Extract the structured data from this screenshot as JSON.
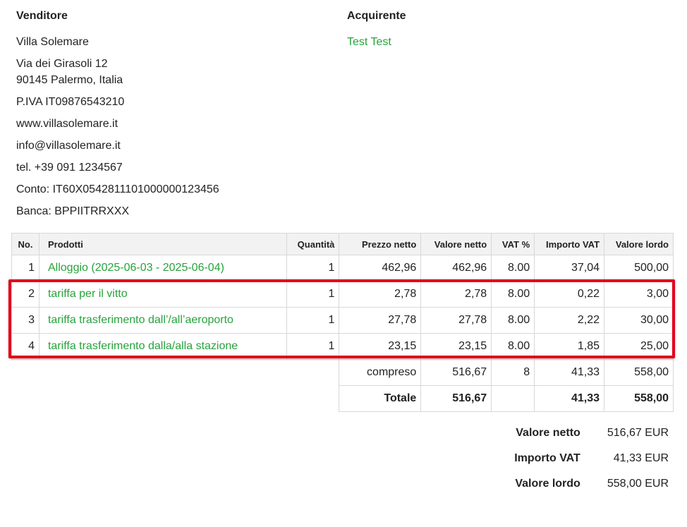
{
  "seller": {
    "heading": "Venditore",
    "name": "Villa Solemare",
    "street": "Via dei Girasoli 12",
    "city": "90145 Palermo, Italia",
    "vat": "P.IVA IT09876543210",
    "website": "www.villasolemare.it",
    "email": "info@villasolemare.it",
    "phone": "tel. +39 091 1234567",
    "account": "Conto: IT60X0542811101000000123456",
    "bank": "Banca: BPPIITRRXXX"
  },
  "buyer": {
    "heading": "Acquirente",
    "name": "Test Test"
  },
  "table": {
    "headers": {
      "no": "No.",
      "product": "Prodotti",
      "qty": "Quantità",
      "net_price": "Prezzo netto",
      "net_value": "Valore netto",
      "vat_pct": "VAT %",
      "vat_amount": "Importo VAT",
      "gross_value": "Valore lordo"
    },
    "rows": [
      {
        "no": "1",
        "product": "Alloggio (2025-06-03 - 2025-06-04)",
        "qty": "1",
        "net_price": "462,96",
        "net_value": "462,96",
        "vat_pct": "8.00",
        "vat_amount": "37,04",
        "gross_value": "500,00"
      },
      {
        "no": "2",
        "product": "tariffa per il vitto",
        "qty": "1",
        "net_price": "2,78",
        "net_value": "2,78",
        "vat_pct": "8.00",
        "vat_amount": "0,22",
        "gross_value": "3,00"
      },
      {
        "no": "3",
        "product": "tariffa trasferimento dall’/all’aeroporto",
        "qty": "1",
        "net_price": "27,78",
        "net_value": "27,78",
        "vat_pct": "8.00",
        "vat_amount": "2,22",
        "gross_value": "30,00"
      },
      {
        "no": "4",
        "product": "tariffa trasferimento dalla/alla stazione",
        "qty": "1",
        "net_price": "23,15",
        "net_value": "23,15",
        "vat_pct": "8.00",
        "vat_amount": "1,85",
        "gross_value": "25,00"
      }
    ],
    "included": {
      "label": "compreso",
      "net_value": "516,67",
      "vat_pct": "8",
      "vat_amount": "41,33",
      "gross_value": "558,00"
    },
    "total": {
      "label": "Totale",
      "net_value": "516,67",
      "vat_amount": "41,33",
      "gross_value": "558,00"
    }
  },
  "summary": {
    "net_label": "Valore netto",
    "net_value": "516,67 EUR",
    "vat_label": "Importo VAT",
    "vat_value": "41,33 EUR",
    "gross_label": "Valore lordo",
    "gross_value": "558,00 EUR"
  },
  "colors": {
    "link_green": "#27a33c",
    "highlight_red": "#e3001b"
  }
}
